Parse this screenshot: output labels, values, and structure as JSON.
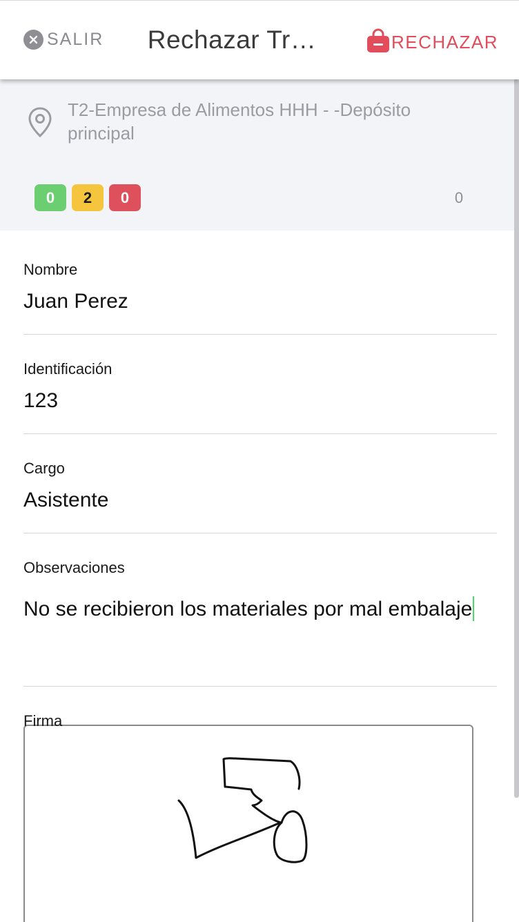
{
  "header": {
    "exit_label": "SALIR",
    "title": "Rechazar Tr…",
    "reject_label": "RECHAZAR",
    "exit_icon": "close-circle-icon",
    "reject_icon": "bag-remove-icon",
    "accent_color": "#e14d5a"
  },
  "info": {
    "location": "T2-Empresa de Alimentos HHH - -Depósito principal",
    "location_icon": "location-pin-icon",
    "badges": [
      {
        "value": "0",
        "color": "#6bcf72"
      },
      {
        "value": "2",
        "color": "#f6c53e"
      },
      {
        "value": "0",
        "color": "#df505d"
      }
    ],
    "count": "0"
  },
  "form": {
    "name": {
      "label": "Nombre",
      "value": "Juan Perez"
    },
    "identification": {
      "label": "Identificación",
      "value": "123"
    },
    "position": {
      "label": "Cargo",
      "value": "Asistente"
    },
    "observations": {
      "label": "Observaciones",
      "value": "No se recibieron los materiales por mal embalaje"
    },
    "signature": {
      "label": "Firma"
    }
  }
}
